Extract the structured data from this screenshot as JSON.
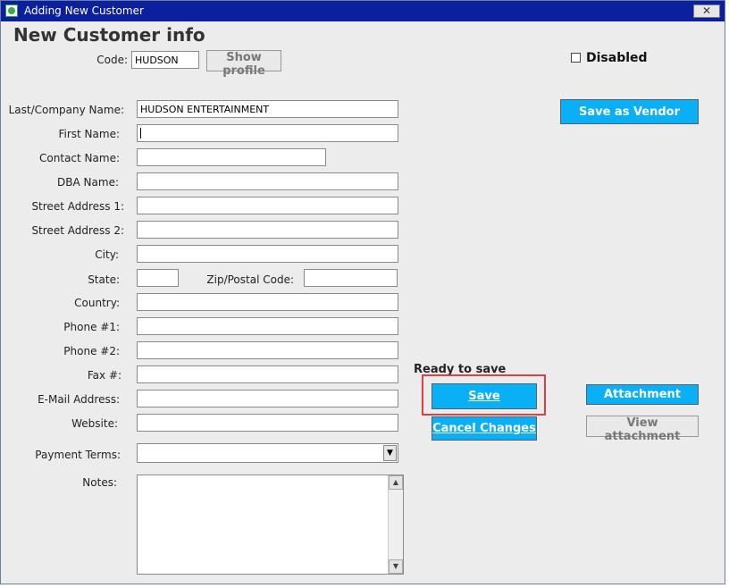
{
  "window": {
    "title": "Adding New Customer",
    "close_symbol": "✕"
  },
  "header": {
    "title": "New Customer info"
  },
  "code": {
    "label": "Code:",
    "value": "HUDSON",
    "show_profile_label": "Show profile"
  },
  "disabled": {
    "label": "Disabled",
    "checked": false
  },
  "form": {
    "last_company_name": {
      "label": "Last/Company Name:",
      "value": "HUDSON ENTERTAINMENT"
    },
    "first_name": {
      "label": "First Name:",
      "value": ""
    },
    "contact_name": {
      "label": "Contact Name:",
      "value": ""
    },
    "dba_name": {
      "label": "DBA Name:",
      "value": ""
    },
    "street_address_1": {
      "label": "Street Address 1:",
      "value": ""
    },
    "street_address_2": {
      "label": "Street Address 2:",
      "value": ""
    },
    "city": {
      "label": "City:",
      "value": ""
    },
    "state": {
      "label": "State:",
      "value": ""
    },
    "zip": {
      "label": "Zip/Postal Code:",
      "value": ""
    },
    "country": {
      "label": "Country:",
      "value": ""
    },
    "phone1": {
      "label": "Phone #1:",
      "value": ""
    },
    "phone2": {
      "label": "Phone #2:",
      "value": ""
    },
    "fax": {
      "label": "Fax #:",
      "value": ""
    },
    "email": {
      "label": "E-Mail Address:",
      "value": ""
    },
    "website": {
      "label": "Website:",
      "value": ""
    },
    "payment_terms": {
      "label": "Payment Terms:",
      "value": ""
    },
    "notes": {
      "label": "Notes:",
      "value": ""
    }
  },
  "actions": {
    "status": "Ready to save",
    "save_label": "Save",
    "cancel_label": "Cancel Changes",
    "save_as_vendor_label": "Save as Vendor",
    "attachment_label": "Attachment",
    "view_attachment_label": "View attachment"
  },
  "colors": {
    "title_bar": "#0c1f9c",
    "accent_button": "#0ab0f5",
    "highlight": "#e04040",
    "window_bg": "#ececec"
  }
}
